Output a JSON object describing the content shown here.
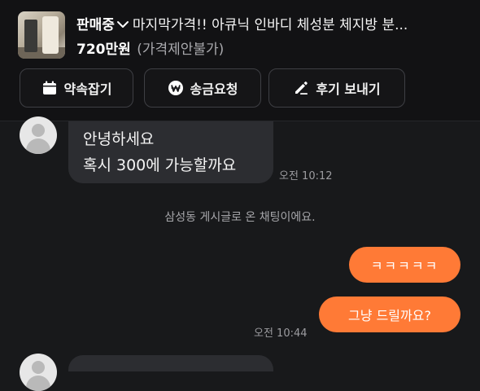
{
  "header": {
    "status": "판매중",
    "title": "마지막가격!! 아큐닉 인바디 체성분 체지방 분...",
    "price": "720만원",
    "price_note": "(가격제안불가)"
  },
  "actions": [
    {
      "label": "약속잡기",
      "icon": "calendar-icon"
    },
    {
      "label": "송금요청",
      "icon": "won-coin-icon"
    },
    {
      "label": "후기 보내기",
      "icon": "pencil-icon"
    }
  ],
  "messages": {
    "incoming": {
      "line1": "안녕하세요",
      "line2": "혹시 300에 가능할까요",
      "time": "오전 10:12"
    },
    "notice": "삼성동 게시글로 온 채팅이에요.",
    "outgoing": [
      {
        "text": "ㅋㅋㅋㅋㅋ"
      },
      {
        "text": "그냥 드릴까요?"
      }
    ],
    "outgoing_time": "오전 10:44"
  },
  "colors": {
    "background": "#18191b",
    "incoming_bubble": "#2c2d31",
    "outgoing_bubble": "#ff7a36"
  }
}
